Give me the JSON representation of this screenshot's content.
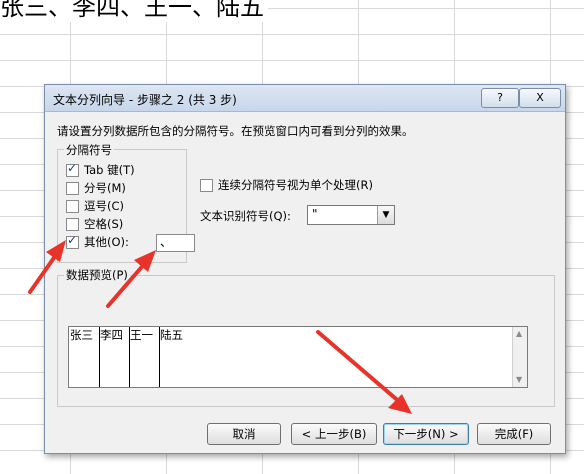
{
  "sheet": {
    "cell_text": "张三、李四、王一、陆五"
  },
  "dialog": {
    "title": "文本分列向导 - 步骤之 2 (共 3 步)",
    "help_label": "?",
    "close_label": "X",
    "instruction": "请设置分列数据所包含的分隔符号。在预览窗口内可看到分列的效果。",
    "delimiters": {
      "title": "分隔符号",
      "options": [
        {
          "label": "Tab 键(T)",
          "checked": true
        },
        {
          "label": "分号(M)",
          "checked": false
        },
        {
          "label": "逗号(C)",
          "checked": false
        },
        {
          "label": "空格(S)",
          "checked": false
        },
        {
          "label": "其他(O):",
          "checked": true
        }
      ],
      "other_value": "、"
    },
    "consecutive_label": "连续分隔符号视为单个处理(R)",
    "text_qualifier": {
      "label": "文本识别符号(Q):",
      "value": "\""
    },
    "preview": {
      "title": "数据预览(P)",
      "cells": [
        "张三",
        "李四",
        "王一",
        "陆五"
      ]
    },
    "buttons": {
      "cancel": "取消",
      "back": "< 上一步(B)",
      "next": "下一步(N) >",
      "finish": "完成(F)"
    }
  },
  "colors": {
    "arrow": "#e8332a",
    "title_bar": "#c7d6ea"
  }
}
